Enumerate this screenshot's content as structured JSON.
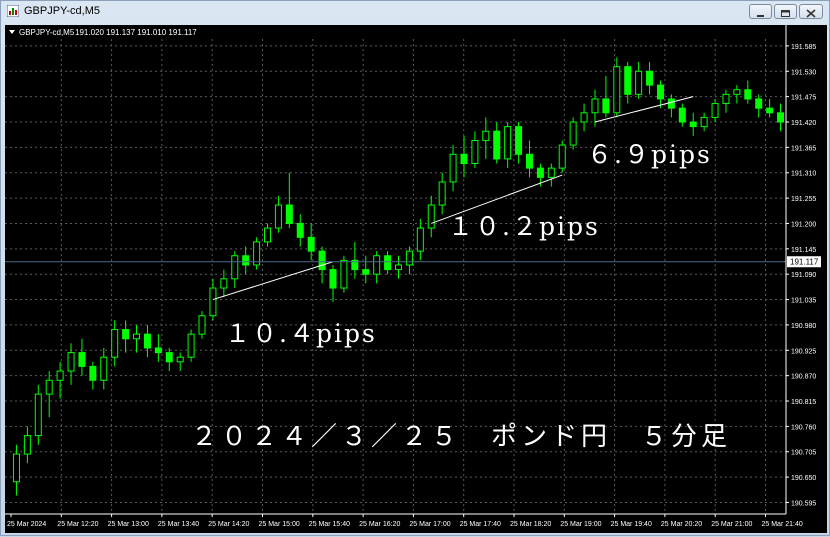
{
  "window": {
    "title": "GBPJPY-cd,M5"
  },
  "chart_header": {
    "symbol": "GBPJPY-cd,M5",
    "ohlc": "191.020 191.137 191.010 191.117"
  },
  "colors": {
    "background": "#000000",
    "grid": "#5a5a5a",
    "bull_candle": "#00ff00",
    "bear_candle": "#00ff00",
    "text": "#ffffff",
    "trend_line": "#ffffff",
    "current_price_line": "#4a6a8a"
  },
  "annotations": {
    "move1": "１０.４pips",
    "move2": "１０.２pips",
    "move3": "６.９pips",
    "caption": "２０２４／３／２５　ポンド円　５分足"
  },
  "chart_data": {
    "type": "candlestick",
    "title": "GBPJPY-cd,M5",
    "xlabel": "",
    "ylabel": "",
    "ylim": [
      190.57,
      191.6
    ],
    "grid": true,
    "price_labels": [
      "191.585",
      "191.530",
      "191.475",
      "191.420",
      "191.365",
      "191.310",
      "191.255",
      "191.200",
      "191.145",
      "191.090",
      "191.035",
      "190.980",
      "190.925",
      "190.870",
      "190.815",
      "190.760",
      "190.705",
      "190.650",
      "190.595"
    ],
    "time_labels": [
      "25 Mar 2024",
      "25 Mar 12:20",
      "25 Mar 13:00",
      "25 Mar 13:40",
      "25 Mar 14:20",
      "25 Mar 15:00",
      "25 Mar 15:40",
      "25 Mar 16:20",
      "25 Mar 17:00",
      "25 Mar 17:40",
      "25 Mar 18:20",
      "25 Mar 19:00",
      "25 Mar 19:40",
      "25 Mar 20:20",
      "25 Mar 21:00",
      "25 Mar 21:40"
    ],
    "current_price": 191.117,
    "current_price_label": "191.117",
    "trend_lines": [
      {
        "from": [
          18,
          191.035
        ],
        "to": [
          29,
          191.117
        ]
      },
      {
        "from": [
          38,
          191.2
        ],
        "to": [
          50,
          191.305
        ]
      },
      {
        "from": [
          53,
          191.42
        ],
        "to": [
          62,
          191.475
        ]
      }
    ],
    "candles": [
      {
        "o": 190.64,
        "h": 190.72,
        "l": 190.61,
        "c": 190.7
      },
      {
        "o": 190.7,
        "h": 190.76,
        "l": 190.68,
        "c": 190.74
      },
      {
        "o": 190.74,
        "h": 190.85,
        "l": 190.72,
        "c": 190.83
      },
      {
        "o": 190.83,
        "h": 190.88,
        "l": 190.78,
        "c": 190.86
      },
      {
        "o": 190.86,
        "h": 190.9,
        "l": 190.82,
        "c": 190.88
      },
      {
        "o": 190.88,
        "h": 190.94,
        "l": 190.85,
        "c": 190.92
      },
      {
        "o": 190.92,
        "h": 190.95,
        "l": 190.87,
        "c": 190.89
      },
      {
        "o": 190.89,
        "h": 190.9,
        "l": 190.84,
        "c": 190.86
      },
      {
        "o": 190.86,
        "h": 190.93,
        "l": 190.84,
        "c": 190.91
      },
      {
        "o": 190.91,
        "h": 190.99,
        "l": 190.89,
        "c": 190.97
      },
      {
        "o": 190.97,
        "h": 190.99,
        "l": 190.92,
        "c": 190.95
      },
      {
        "o": 190.95,
        "h": 190.98,
        "l": 190.92,
        "c": 190.96
      },
      {
        "o": 190.96,
        "h": 190.98,
        "l": 190.91,
        "c": 190.93
      },
      {
        "o": 190.93,
        "h": 190.96,
        "l": 190.9,
        "c": 190.92
      },
      {
        "o": 190.92,
        "h": 190.93,
        "l": 190.88,
        "c": 190.9
      },
      {
        "o": 190.9,
        "h": 190.92,
        "l": 190.88,
        "c": 190.91
      },
      {
        "o": 190.91,
        "h": 190.97,
        "l": 190.9,
        "c": 190.96
      },
      {
        "o": 190.96,
        "h": 191.01,
        "l": 190.95,
        "c": 191.0
      },
      {
        "o": 191.0,
        "h": 191.08,
        "l": 190.99,
        "c": 191.06
      },
      {
        "o": 191.06,
        "h": 191.1,
        "l": 191.04,
        "c": 191.08
      },
      {
        "o": 191.08,
        "h": 191.14,
        "l": 191.06,
        "c": 191.13
      },
      {
        "o": 191.13,
        "h": 191.15,
        "l": 191.09,
        "c": 191.11
      },
      {
        "o": 191.11,
        "h": 191.17,
        "l": 191.1,
        "c": 191.16
      },
      {
        "o": 191.16,
        "h": 191.2,
        "l": 191.15,
        "c": 191.19
      },
      {
        "o": 191.19,
        "h": 191.26,
        "l": 191.18,
        "c": 191.24
      },
      {
        "o": 191.24,
        "h": 191.31,
        "l": 191.19,
        "c": 191.2
      },
      {
        "o": 191.2,
        "h": 191.22,
        "l": 191.15,
        "c": 191.17
      },
      {
        "o": 191.17,
        "h": 191.2,
        "l": 191.12,
        "c": 191.14
      },
      {
        "o": 191.14,
        "h": 191.15,
        "l": 191.07,
        "c": 191.1
      },
      {
        "o": 191.1,
        "h": 191.11,
        "l": 191.03,
        "c": 191.06
      },
      {
        "o": 191.06,
        "h": 191.13,
        "l": 191.05,
        "c": 191.12
      },
      {
        "o": 191.12,
        "h": 191.16,
        "l": 191.08,
        "c": 191.1
      },
      {
        "o": 191.1,
        "h": 191.13,
        "l": 191.07,
        "c": 191.09
      },
      {
        "o": 191.09,
        "h": 191.14,
        "l": 191.07,
        "c": 191.13
      },
      {
        "o": 191.13,
        "h": 191.14,
        "l": 191.09,
        "c": 191.1
      },
      {
        "o": 191.1,
        "h": 191.13,
        "l": 191.08,
        "c": 191.11
      },
      {
        "o": 191.11,
        "h": 191.15,
        "l": 191.09,
        "c": 191.14
      },
      {
        "o": 191.14,
        "h": 191.21,
        "l": 191.12,
        "c": 191.19
      },
      {
        "o": 191.19,
        "h": 191.26,
        "l": 191.17,
        "c": 191.24
      },
      {
        "o": 191.24,
        "h": 191.31,
        "l": 191.22,
        "c": 191.29
      },
      {
        "o": 191.29,
        "h": 191.37,
        "l": 191.27,
        "c": 191.35
      },
      {
        "o": 191.35,
        "h": 191.39,
        "l": 191.3,
        "c": 191.33
      },
      {
        "o": 191.33,
        "h": 191.4,
        "l": 191.32,
        "c": 191.38
      },
      {
        "o": 191.38,
        "h": 191.43,
        "l": 191.34,
        "c": 191.4
      },
      {
        "o": 191.4,
        "h": 191.42,
        "l": 191.33,
        "c": 191.34
      },
      {
        "o": 191.34,
        "h": 191.42,
        "l": 191.32,
        "c": 191.41
      },
      {
        "o": 191.41,
        "h": 191.42,
        "l": 191.33,
        "c": 191.35
      },
      {
        "o": 191.35,
        "h": 191.38,
        "l": 191.3,
        "c": 191.32
      },
      {
        "o": 191.32,
        "h": 191.33,
        "l": 191.28,
        "c": 191.3
      },
      {
        "o": 191.3,
        "h": 191.33,
        "l": 191.28,
        "c": 191.32
      },
      {
        "o": 191.32,
        "h": 191.38,
        "l": 191.31,
        "c": 191.37
      },
      {
        "o": 191.37,
        "h": 191.43,
        "l": 191.36,
        "c": 191.42
      },
      {
        "o": 191.42,
        "h": 191.46,
        "l": 191.4,
        "c": 191.44
      },
      {
        "o": 191.44,
        "h": 191.49,
        "l": 191.41,
        "c": 191.47
      },
      {
        "o": 191.47,
        "h": 191.52,
        "l": 191.43,
        "c": 191.44
      },
      {
        "o": 191.44,
        "h": 191.56,
        "l": 191.43,
        "c": 191.54
      },
      {
        "o": 191.54,
        "h": 191.55,
        "l": 191.46,
        "c": 191.48
      },
      {
        "o": 191.48,
        "h": 191.55,
        "l": 191.47,
        "c": 191.53
      },
      {
        "o": 191.53,
        "h": 191.55,
        "l": 191.48,
        "c": 191.5
      },
      {
        "o": 191.5,
        "h": 191.51,
        "l": 191.45,
        "c": 191.47
      },
      {
        "o": 191.47,
        "h": 191.48,
        "l": 191.43,
        "c": 191.45
      },
      {
        "o": 191.45,
        "h": 191.46,
        "l": 191.41,
        "c": 191.42
      },
      {
        "o": 191.42,
        "h": 191.44,
        "l": 191.39,
        "c": 191.41
      },
      {
        "o": 191.41,
        "h": 191.44,
        "l": 191.4,
        "c": 191.43
      },
      {
        "o": 191.43,
        "h": 191.47,
        "l": 191.42,
        "c": 191.46
      },
      {
        "o": 191.46,
        "h": 191.49,
        "l": 191.44,
        "c": 191.48
      },
      {
        "o": 191.48,
        "h": 191.5,
        "l": 191.46,
        "c": 191.49
      },
      {
        "o": 191.49,
        "h": 191.51,
        "l": 191.46,
        "c": 191.47
      },
      {
        "o": 191.47,
        "h": 191.48,
        "l": 191.43,
        "c": 191.45
      },
      {
        "o": 191.45,
        "h": 191.47,
        "l": 191.43,
        "c": 191.44
      },
      {
        "o": 191.44,
        "h": 191.46,
        "l": 191.4,
        "c": 191.42
      }
    ]
  }
}
